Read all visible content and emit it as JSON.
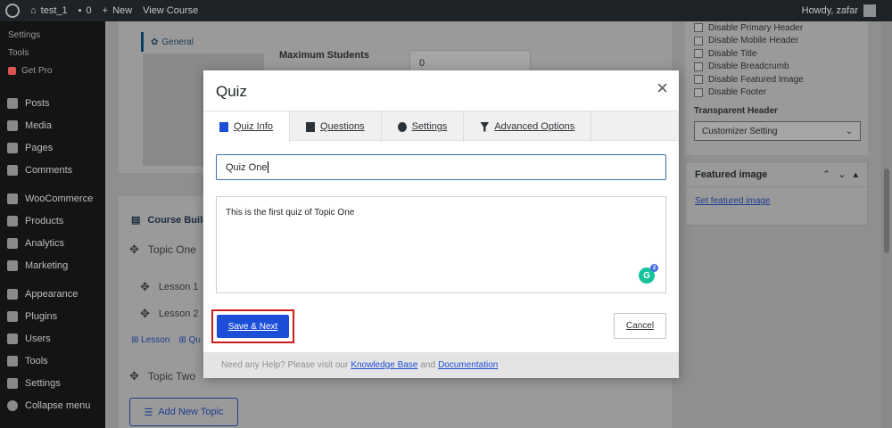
{
  "adminbar": {
    "site_name": "test_1",
    "comments_count": "0",
    "new_label": "New",
    "view_course_label": "View Course",
    "greeting": "Howdy, zafar"
  },
  "sidebar": {
    "sub_items": [
      "Settings",
      "Tools",
      "Get Pro"
    ],
    "items": [
      {
        "label": "Posts",
        "icon": "pin-icon"
      },
      {
        "label": "Media",
        "icon": "media-icon"
      },
      {
        "label": "Pages",
        "icon": "pages-icon"
      },
      {
        "label": "Comments",
        "icon": "comments-icon"
      },
      {
        "label": "WooCommerce",
        "icon": "woocommerce-icon"
      },
      {
        "label": "Products",
        "icon": "products-icon"
      },
      {
        "label": "Analytics",
        "icon": "analytics-icon"
      },
      {
        "label": "Marketing",
        "icon": "marketing-icon"
      },
      {
        "label": "Appearance",
        "icon": "appearance-icon"
      },
      {
        "label": "Plugins",
        "icon": "plugins-icon"
      },
      {
        "label": "Users",
        "icon": "users-icon"
      },
      {
        "label": "Tools",
        "icon": "tools-icon"
      },
      {
        "label": "Settings",
        "icon": "settings-icon"
      },
      {
        "label": "Collapse menu",
        "icon": "collapse-icon"
      }
    ]
  },
  "course": {
    "general_tab": "General",
    "max_students_label": "Maximum Students",
    "max_students_value": "0",
    "builder_title": "Course Builde",
    "topic_one": "Topic One",
    "lesson_one": "Lesson 1",
    "lesson_two": "Lesson 2",
    "add_lesson": "Lesson",
    "add_quiz": "Qu",
    "topic_two": "Topic Two",
    "add_topic": "Add New Topic"
  },
  "right_panel": {
    "options": [
      "Disable Primary Header",
      "Disable Mobile Header",
      "Disable Title",
      "Disable Breadcrumb",
      "Disable Featured Image",
      "Disable Footer"
    ],
    "transparent_header_label": "Transparent Header",
    "transparent_header_value": "Customizer Setting",
    "featured_image_title": "Featured image",
    "set_featured_image": "Set featured image"
  },
  "modal": {
    "title": "Quiz",
    "tabs": [
      {
        "label": "Quiz Info",
        "icon": "clipboard-icon"
      },
      {
        "label": "Questions",
        "icon": "question-icon"
      },
      {
        "label": "Settings",
        "icon": "gear-icon"
      },
      {
        "label": "Advanced Options",
        "icon": "funnel-icon"
      }
    ],
    "quiz_title_value": "Quiz One",
    "quiz_description": "This is the first quiz of Topic One",
    "grammarly_count": "2",
    "save_label": "Save & Next",
    "cancel_label": "Cancel",
    "footer_text": "Need any Help? Please visit our",
    "footer_link_1": "Knowledge Base",
    "footer_and": "and",
    "footer_link_2": "Documentation"
  }
}
